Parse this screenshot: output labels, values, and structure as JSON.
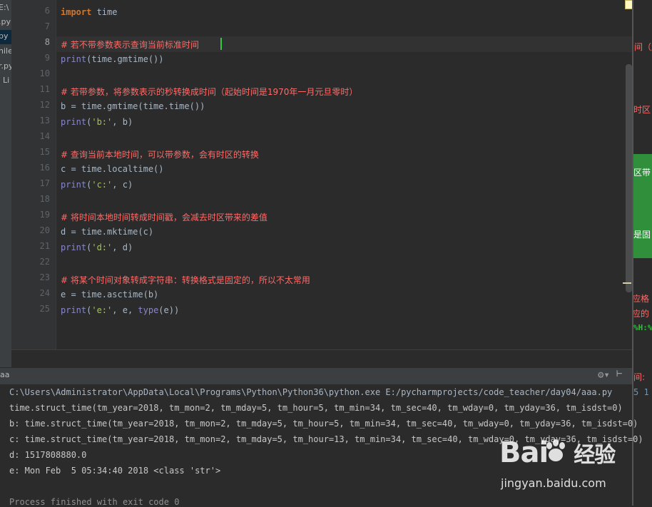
{
  "project": {
    "items": [
      "E:\\",
      ".py",
      "py",
      "hile",
      "r.py",
      "Li"
    ]
  },
  "editor": {
    "line_numbers": [
      "6",
      "7",
      "8",
      "9",
      "10",
      "11",
      "12",
      "13",
      "14",
      "15",
      "16",
      "17",
      "18",
      "19",
      "20",
      "21",
      "22",
      "23",
      "24",
      "25"
    ],
    "lines": [
      {
        "num": "6",
        "tokens": [
          {
            "t": "import",
            "c": "kw"
          },
          {
            "t": " time",
            "c": ""
          }
        ]
      },
      {
        "num": "7",
        "tokens": []
      },
      {
        "num": "8",
        "tokens": [
          {
            "t": "# 若不带参数表示查询当前标准时间",
            "c": "cm"
          }
        ]
      },
      {
        "num": "9",
        "tokens": [
          {
            "t": "print",
            "c": "fn"
          },
          {
            "t": "(time.gmtime())",
            "c": ""
          }
        ]
      },
      {
        "num": "10",
        "tokens": []
      },
      {
        "num": "11",
        "tokens": [
          {
            "t": "# 若带参数，将参数表示的秒转换成时间（起始时间是1970年一月元旦零时）",
            "c": "cm"
          }
        ]
      },
      {
        "num": "12",
        "tokens": [
          {
            "t": "b ",
            "c": ""
          },
          {
            "t": "=",
            "c": ""
          },
          {
            "t": " time.gmtime(time.time())",
            "c": ""
          }
        ]
      },
      {
        "num": "13",
        "tokens": [
          {
            "t": "print",
            "c": "fn"
          },
          {
            "t": "(",
            "c": ""
          },
          {
            "t": "'b:'",
            "c": "st"
          },
          {
            "t": ", b)",
            "c": ""
          }
        ]
      },
      {
        "num": "14",
        "tokens": []
      },
      {
        "num": "15",
        "tokens": [
          {
            "t": "# 查询当前本地时间，可以带参数，会有时区的转换",
            "c": "cm"
          }
        ]
      },
      {
        "num": "16",
        "tokens": [
          {
            "t": "c = time.localtime()",
            "c": ""
          }
        ]
      },
      {
        "num": "17",
        "tokens": [
          {
            "t": "print",
            "c": "fn"
          },
          {
            "t": "(",
            "c": ""
          },
          {
            "t": "'c:'",
            "c": "st"
          },
          {
            "t": ", c)",
            "c": ""
          }
        ]
      },
      {
        "num": "18",
        "tokens": []
      },
      {
        "num": "19",
        "tokens": [
          {
            "t": "# 将时间本地时间转成时间戳，会减去时区带来的差值",
            "c": "cm"
          }
        ]
      },
      {
        "num": "20",
        "tokens": [
          {
            "t": "d = time.mktime(c)",
            "c": ""
          }
        ]
      },
      {
        "num": "21",
        "tokens": [
          {
            "t": "print",
            "c": "fn"
          },
          {
            "t": "(",
            "c": ""
          },
          {
            "t": "'d:'",
            "c": "st"
          },
          {
            "t": ", d)",
            "c": ""
          }
        ]
      },
      {
        "num": "22",
        "tokens": []
      },
      {
        "num": "23",
        "tokens": [
          {
            "t": "# 将某个时间对象转成字符串：转换格式是固定的，所以不太常用",
            "c": "cm"
          }
        ]
      },
      {
        "num": "24",
        "tokens": [
          {
            "t": "e = time.asctime(b)",
            "c": ""
          }
        ]
      },
      {
        "num": "25",
        "tokens": [
          {
            "t": "print",
            "c": "fn"
          },
          {
            "t": "(",
            "c": ""
          },
          {
            "t": "'e:'",
            "c": "st"
          },
          {
            "t": ", e, ",
            "c": ""
          },
          {
            "t": "type",
            "c": "fn"
          },
          {
            "t": "(e))",
            "c": ""
          }
        ]
      }
    ]
  },
  "right_panel": {
    "texts": [
      "间（起",
      "时区",
      "区带",
      "是固",
      "应格",
      "应的",
      "%H:%",
      "间:",
      "5 1"
    ]
  },
  "run": {
    "tab_label": "aa",
    "gear_icon": "gear-icon",
    "output": [
      "C:\\Users\\Administrator\\AppData\\Local\\Programs\\Python\\Python36\\python.exe E:/pycharmprojects/code_teacher/day04/aaa.py",
      "time.struct_time(tm_year=2018, tm_mon=2, tm_mday=5, tm_hour=5, tm_min=34, tm_sec=40, tm_wday=0, tm_yday=36, tm_isdst=0)",
      "b: time.struct_time(tm_year=2018, tm_mon=2, tm_mday=5, tm_hour=5, tm_min=34, tm_sec=40, tm_wday=0, tm_yday=36, tm_isdst=0)",
      "c: time.struct_time(tm_year=2018, tm_mon=2, tm_mday=5, tm_hour=13, tm_min=34, tm_sec=40, tm_wday=0, tm_yday=36, tm_isdst=0)",
      "d: 1517808880.0",
      "e: Mon Feb  5 05:34:40 2018 <class 'str'>",
      "",
      "Process finished with exit code 0"
    ]
  },
  "watermark": {
    "logo": "Bai",
    "logo2": "经验",
    "url": "jingyan.baidu.com"
  },
  "colors": {
    "background": "#2b2b2b",
    "comment": "#ff6b68",
    "keyword": "#cc7832",
    "string": "#a5c25c",
    "caret": "#2ecc40"
  }
}
